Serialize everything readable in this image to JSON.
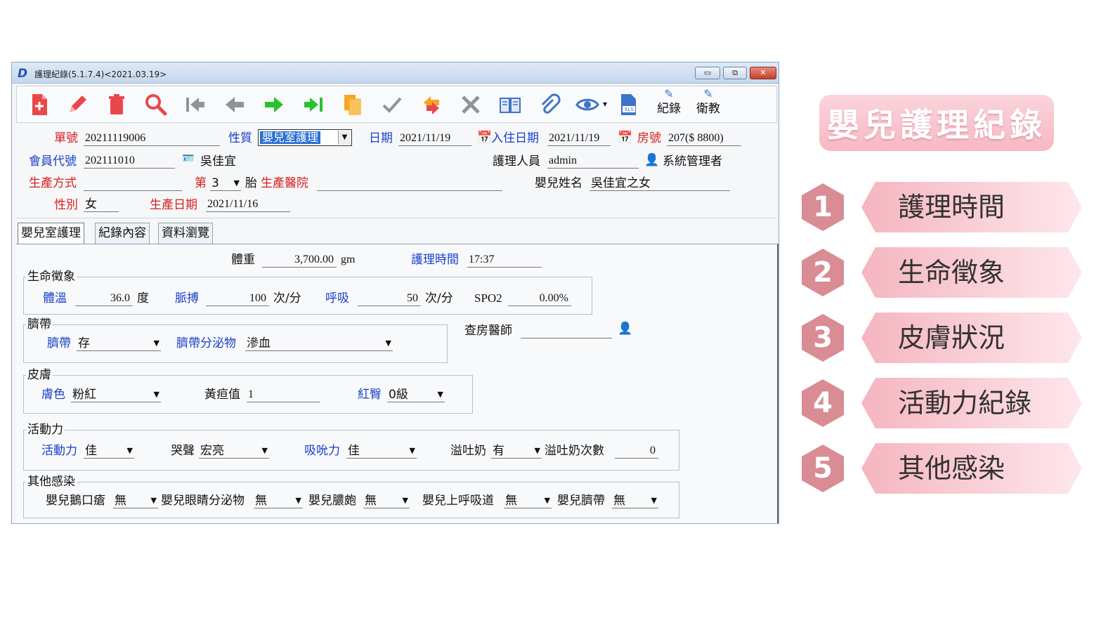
{
  "window": {
    "title": "護理紀錄(5.1.7.4)<2021.03.19>",
    "buttons": {
      "minimize": "▭",
      "restore": "⧉",
      "close": "✕"
    }
  },
  "toolbar": {
    "items": [
      "new-record-icon",
      "edit-pencil-icon",
      "delete-trash-icon",
      "search-icon",
      "first-record-icon",
      "prev-record-icon",
      "next-record-icon",
      "last-record-icon",
      "copy-icon",
      "confirm-check-icon",
      "refresh-icon",
      "cancel-x-icon",
      "book-icon",
      "attachment-icon",
      "view-eye-icon",
      "export-xls-icon"
    ],
    "record_label": "紀錄",
    "education_label": "衛教",
    "view_dropdown": "▾"
  },
  "header": {
    "order_no_label": "單號",
    "order_no": "20211119006",
    "type_label": "性質",
    "type_value": "嬰兒室護理",
    "date_label": "日期",
    "date": "2021/11/19",
    "admit_label": "入住日期",
    "admit_date": "2021/11/19",
    "room_label": "房號",
    "room": "207($ 8800)",
    "member_label": "會員代號",
    "member_id": "202111010",
    "member_name": "吳佳宜",
    "nurse_label": "護理人員",
    "nurse": "admin",
    "nurse_role": "系統管理者",
    "delivery_label": "生產方式",
    "delivery": "",
    "birth_order_label": "第",
    "birth_order": "3",
    "fetus_label": "胎",
    "hospital_label": "生產醫院",
    "hospital": "",
    "baby_name_label": "嬰兒姓名",
    "baby_name": "吳佳宜之女",
    "sex_label": "性別",
    "sex": "女",
    "birth_date_label": "生產日期",
    "birth_date": "2021/11/16"
  },
  "tabs": [
    "嬰兒室護理",
    "紀錄內容",
    "資料瀏覽"
  ],
  "form": {
    "weight_label": "體重",
    "weight": "3,700.00",
    "weight_unit": "gm",
    "care_time_label": "護理時間",
    "care_time": "17:37",
    "vitals": {
      "title": "生命徵象",
      "temp_label": "體溫",
      "temp": "36.0",
      "temp_unit": "度",
      "pulse_label": "脈搏",
      "pulse": "100",
      "pulse_unit": "次/分",
      "resp_label": "呼吸",
      "resp": "50",
      "resp_unit": "次/分",
      "spo2_label": "SPO2",
      "spo2": "0.00%"
    },
    "cord": {
      "title": "臍帶",
      "cord_label": "臍帶",
      "cord": "存",
      "secretion_label": "臍帶分泌物",
      "secretion": "滲血"
    },
    "doctor_label": "查房醫師",
    "doctor": "",
    "skin": {
      "title": "皮膚",
      "color_label": "膚色",
      "color": "粉紅",
      "jaundice_label": "黃疸值",
      "jaundice": "1",
      "rash_label": "紅臀",
      "rash": "0級"
    },
    "activity": {
      "title": "活動力",
      "activity_label": "活動力",
      "activity": "佳",
      "cry_label": "哭聲",
      "cry": "宏亮",
      "suck_label": "吸吮力",
      "suck": "佳",
      "spit_label": "溢吐奶",
      "spit": "有",
      "spit_count_label": "溢吐奶次數",
      "spit_count": "0"
    },
    "infection": {
      "title": "其他感染",
      "thrush_label": "嬰兒鵝口瘡",
      "thrush": "無",
      "eye_label": "嬰兒眼睛分泌物",
      "eye": "無",
      "pustule_label": "嬰兒膿皰",
      "pustule": "無",
      "uri_label": "嬰兒上呼吸道",
      "uri": "無",
      "navel_label": "嬰兒臍帶",
      "navel": "無"
    }
  },
  "side": {
    "title": "嬰兒護理紀錄",
    "items": [
      {
        "num": "1",
        "label": "護理時間"
      },
      {
        "num": "2",
        "label": "生命徵象"
      },
      {
        "num": "3",
        "label": "皮膚狀況"
      },
      {
        "num": "4",
        "label": "活動力紀錄"
      },
      {
        "num": "5",
        "label": "其他感染"
      }
    ],
    "colors": {
      "hex": "#d98c94",
      "pill_start": "#f5b5c0",
      "pill_end": "#fde7ec"
    }
  }
}
